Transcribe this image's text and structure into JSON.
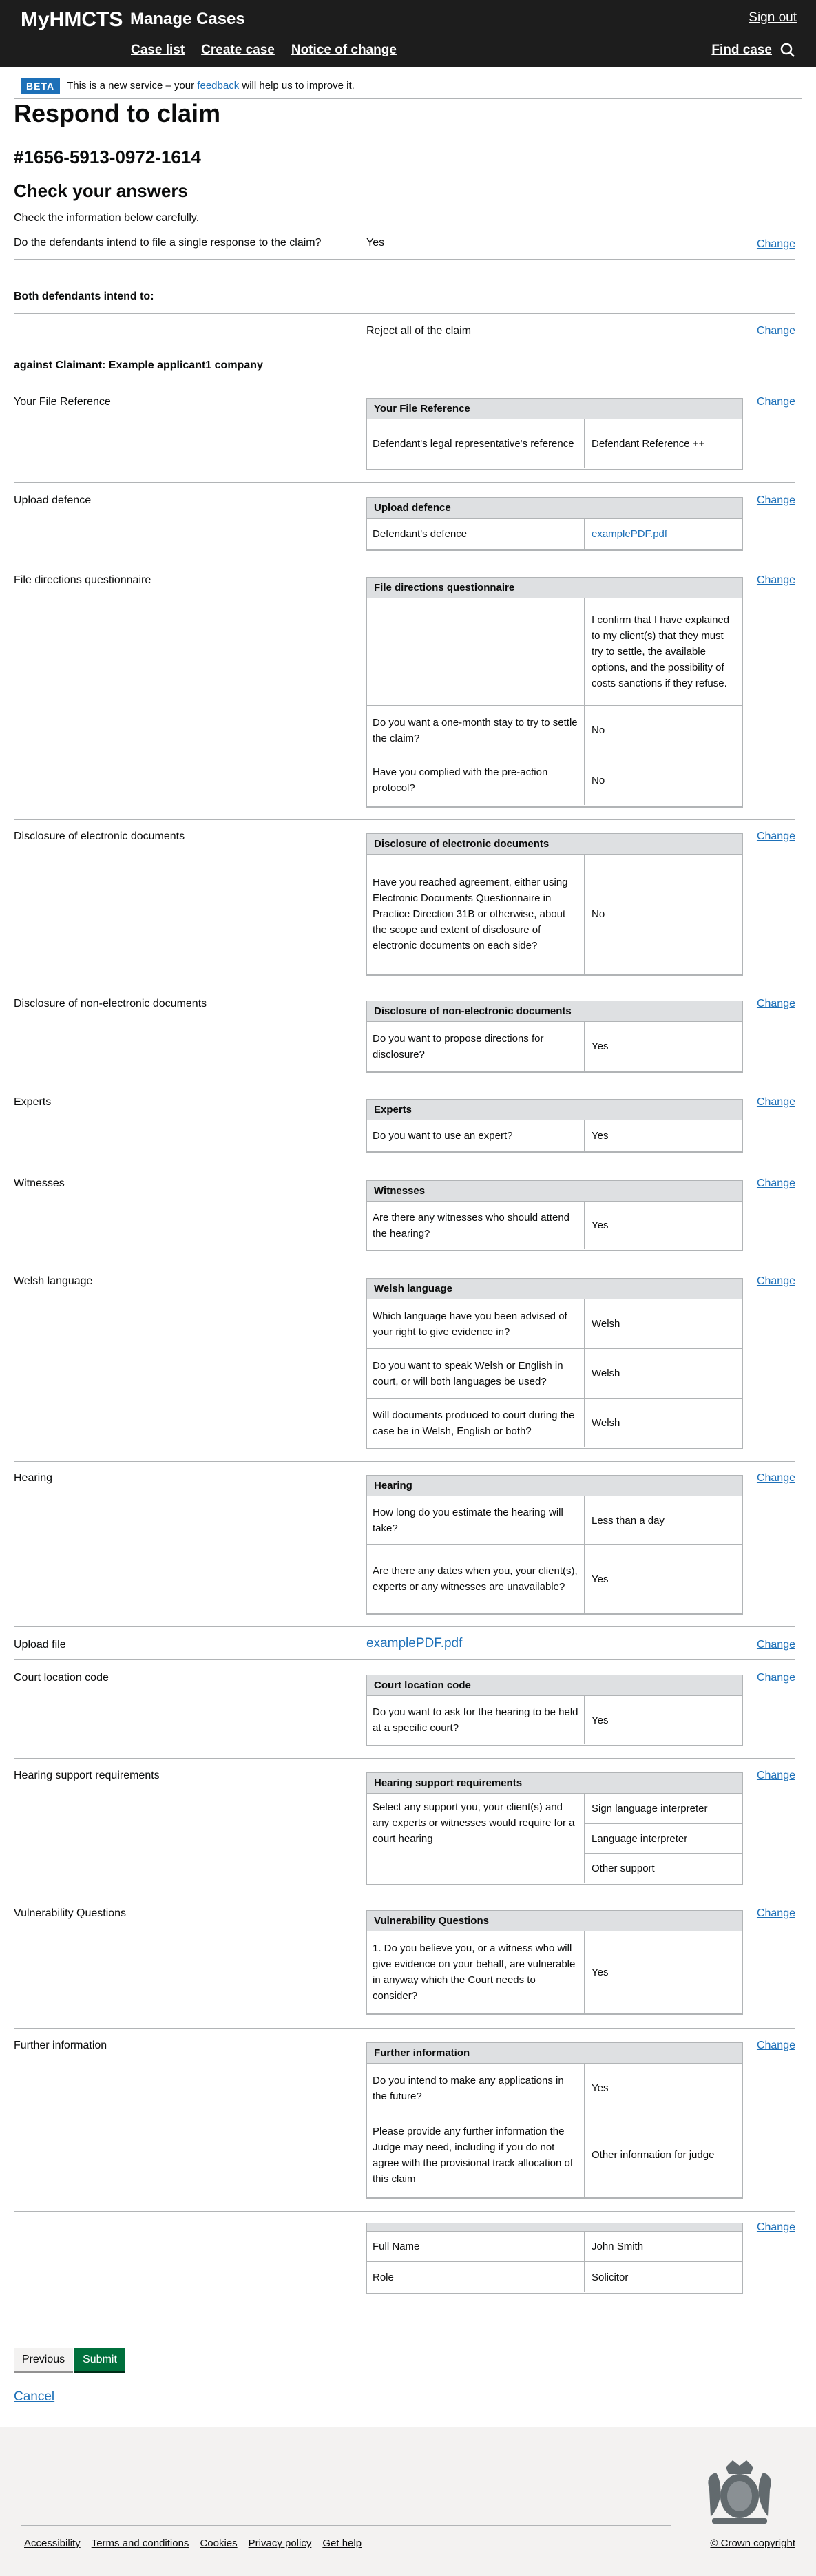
{
  "header": {
    "brand": "MyHMCTS",
    "service": "Manage Cases",
    "signout": "Sign out",
    "nav": [
      "Case list",
      "Create case",
      "Notice of change"
    ],
    "find_case": "Find case"
  },
  "phase": {
    "tag": "BETA",
    "text_before": "This is a new service – your",
    "link": "feedback",
    "text_after": "will help us to improve it."
  },
  "page": {
    "title": "Respond to claim",
    "case_number": "#1656-5913-0972-1614",
    "check_heading": "Check your answers",
    "check_intro": "Check the information below carefully."
  },
  "change_label": "Change",
  "single_response": {
    "label": "Do the defendants intend to file a single response to the claim?",
    "value": "Yes"
  },
  "both_defendants": {
    "label": "Both defendants intend to:",
    "value": "Reject all of the claim"
  },
  "against": "against Claimant: Example applicant1 company",
  "file_reference": {
    "label": "Your File Reference",
    "header": "Your File Reference",
    "rows": [
      {
        "q": "Defendant's legal representative's reference",
        "a": "Defendant Reference ++"
      }
    ]
  },
  "upload_defence": {
    "label": "Upload defence",
    "header": "Upload defence",
    "rows": [
      {
        "q": "Defendant's defence",
        "a": "examplePDF.pdf"
      }
    ]
  },
  "dq": {
    "label": "File directions questionnaire",
    "header": "File directions questionnaire",
    "rows": [
      {
        "q": "",
        "a": "I confirm that I have explained to my client(s) that they must try to settle, the available options, and the possibility of costs sanctions if they refuse."
      },
      {
        "q": "Do you want a one-month stay to try to settle the claim?",
        "a": "No"
      },
      {
        "q": "Have you complied with the pre-action protocol?",
        "a": "No"
      }
    ]
  },
  "disclosure_electronic": {
    "label": "Disclosure of electronic documents",
    "header": "Disclosure of electronic documents",
    "rows": [
      {
        "q": "Have you reached agreement, either using Electronic Documents Questionnaire in Practice Direction 31B or otherwise, about the scope and extent of disclosure of electronic documents on each side?",
        "a": "No"
      }
    ]
  },
  "disclosure_non_electronic": {
    "label": "Disclosure of non-electronic documents",
    "header": "Disclosure of non-electronic documents",
    "rows": [
      {
        "q": "Do you want to propose directions for disclosure?",
        "a": "Yes"
      }
    ]
  },
  "experts": {
    "label": "Experts",
    "header": "Experts",
    "rows": [
      {
        "q": "Do you want to use an expert?",
        "a": "Yes"
      }
    ]
  },
  "witnesses": {
    "label": "Witnesses",
    "header": "Witnesses",
    "rows": [
      {
        "q": "Are there any witnesses who should attend the hearing?",
        "a": "Yes"
      }
    ]
  },
  "welsh": {
    "label": "Welsh language",
    "header": "Welsh language",
    "rows": [
      {
        "q": "Which language have you been advised of your right to give evidence in?",
        "a": "Welsh"
      },
      {
        "q": "Do you want to speak Welsh or English in court, or will both languages be used?",
        "a": "Welsh"
      },
      {
        "q": "Will documents produced to court during the case be in Welsh, English or both?",
        "a": "Welsh"
      }
    ]
  },
  "hearing": {
    "label": "Hearing",
    "header": "Hearing",
    "rows": [
      {
        "q": "How long do you estimate the hearing will take?",
        "a": "Less than a day"
      },
      {
        "q": "Are there any dates when you, your client(s), experts or any witnesses are unavailable?",
        "a": "Yes"
      }
    ]
  },
  "upload_file": {
    "label": "Upload file",
    "value": "examplePDF.pdf"
  },
  "court_location": {
    "label": "Court location code",
    "header": "Court location code",
    "rows": [
      {
        "q": "Do you want to ask for the hearing to be held at a specific court?",
        "a": "Yes"
      }
    ]
  },
  "hearing_support": {
    "label": "Hearing support requirements",
    "header": "Hearing support requirements",
    "q": "Select any support you, your client(s) and any experts or witnesses would require for a court hearing",
    "answers": [
      "Sign language interpreter",
      "Language interpreter",
      "Other support"
    ]
  },
  "vulnerability": {
    "label": "Vulnerability Questions",
    "header": "Vulnerability Questions",
    "rows": [
      {
        "q": "1. Do you believe you, or a witness who will give evidence on your behalf, are vulnerable in anyway which the Court needs to consider?",
        "a": "Yes"
      }
    ]
  },
  "further_info": {
    "label": "Further information",
    "header": "Further information",
    "rows": [
      {
        "q": "Do you intend to make any applications in the future?",
        "a": "Yes"
      },
      {
        "q": "Please provide any further information the Judge may need, including if you do not agree with the provisional track allocation of this claim",
        "a": "Other information for judge"
      }
    ]
  },
  "statement": {
    "rows": [
      {
        "q": "Full Name",
        "a": "John Smith"
      },
      {
        "q": "Role",
        "a": "Solicitor"
      }
    ]
  },
  "buttons": {
    "previous": "Previous",
    "submit": "Submit",
    "cancel": "Cancel"
  },
  "footer": {
    "links": [
      "Accessibility",
      "Terms and conditions",
      "Cookies",
      "Privacy policy",
      "Get help"
    ],
    "copyright": "© Crown copyright"
  },
  "colors": {
    "header_bg": "#1d1d1d",
    "link": "#1d70b8",
    "submit_green": "#00703c",
    "table_header": "#dee0e2",
    "footer_bg": "#f3f2f1"
  }
}
